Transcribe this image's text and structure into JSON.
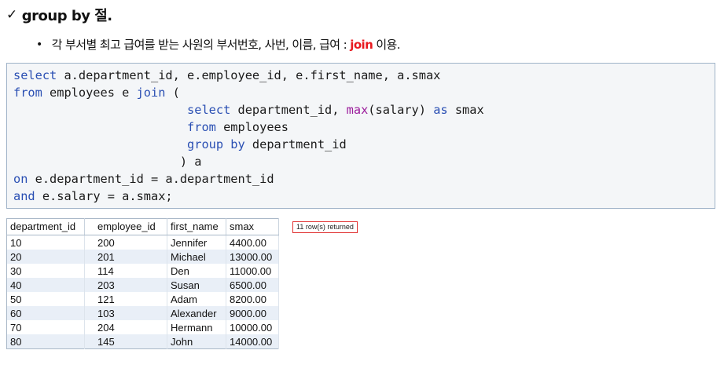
{
  "heading": {
    "check": "✓",
    "text": "group by 절."
  },
  "bullet": {
    "dot": "•",
    "text_before": "각 부서별 최고 급여를 받는 사원의 부서번호, 사번, 이름, 급여 : ",
    "highlight": "join",
    "text_after": " 이용."
  },
  "code": {
    "line1_kw": "select",
    "line1_rest": " a.department_id, e.employee_id, e.first_name, a.smax",
    "line2_kw": "from",
    "line2_mid": " employees e ",
    "line2_kw2": "join",
    "line2_rest": " (",
    "line3_indent": "                        ",
    "line3_kw": "select",
    "line3_mid": " department_id, ",
    "line3_fn": "max",
    "line3_mid2": "(salary) ",
    "line3_kw2": "as",
    "line3_rest": " smax",
    "line4_indent": "                        ",
    "line4_kw": "from",
    "line4_rest": " employees",
    "line5_indent": "                        ",
    "line5_kw": "group by",
    "line5_rest": " department_id",
    "line6": "                       ) a",
    "line7_kw": "on",
    "line7_rest": " e.department_id = a.department_id",
    "line8_kw": "and",
    "line8_rest": " e.salary = a.smax;"
  },
  "table": {
    "headers": [
      "department_id",
      "employee_id",
      "first_name",
      "smax"
    ],
    "rows": [
      [
        "10",
        "200",
        "Jennifer",
        "4400.00"
      ],
      [
        "20",
        "201",
        "Michael",
        "13000.00"
      ],
      [
        "30",
        "114",
        "Den",
        "11000.00"
      ],
      [
        "40",
        "203",
        "Susan",
        "6500.00"
      ],
      [
        "50",
        "121",
        "Adam",
        "8200.00"
      ],
      [
        "60",
        "103",
        "Alexander",
        "9000.00"
      ],
      [
        "70",
        "204",
        "Hermann",
        "10000.00"
      ],
      [
        "80",
        "145",
        "John",
        "14000.00"
      ]
    ]
  },
  "status": "11 row(s) returned",
  "colors": {
    "keyword": "#2a4fb3",
    "function": "#9b1b9b",
    "highlight": "#e8191f",
    "badge_border": "#e03030"
  }
}
